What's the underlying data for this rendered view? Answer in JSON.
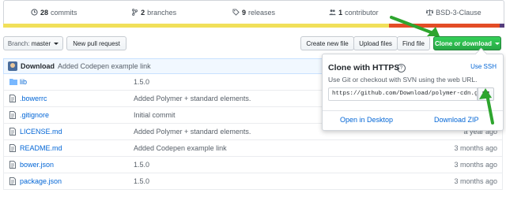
{
  "stats": {
    "commits": {
      "count": "28",
      "label": "commits",
      "icon": "history-icon"
    },
    "branches": {
      "count": "2",
      "label": "branches",
      "icon": "branch-icon"
    },
    "releases": {
      "count": "9",
      "label": "releases",
      "icon": "tag-icon"
    },
    "contributors": {
      "count": "1",
      "label": "contributor",
      "icon": "people-icon"
    },
    "license": {
      "label": "BSD-3-Clause",
      "icon": "law-icon"
    }
  },
  "colors": {
    "lang_yellow": "#f1e05a",
    "lang_red": "#e34c26",
    "lang_blue": "#563d7c",
    "green_button": "#28a745",
    "link": "#0366d6",
    "arrow": "#2ea52e"
  },
  "toolbar": {
    "branch_prefix": "Branch:",
    "branch_name": "master",
    "new_pull_request": "New pull request",
    "create_new_file": "Create new file",
    "upload_files": "Upload files",
    "find_file": "Find file",
    "clone_download": "Clone or download"
  },
  "latest_commit": {
    "author": "Download",
    "message": "Added Codepen example link"
  },
  "files": [
    {
      "name": "lib",
      "type": "folder",
      "message": "1.5.0",
      "age": ""
    },
    {
      "name": ".bowerrc",
      "type": "file",
      "message": "Added Polymer + standard elements.",
      "age": ""
    },
    {
      "name": ".gitignore",
      "type": "file",
      "message": "Initial commit",
      "age": ""
    },
    {
      "name": "LICENSE.md",
      "type": "file",
      "message": "Added Polymer + standard elements.",
      "age": "a year ago"
    },
    {
      "name": "README.md",
      "type": "file",
      "message": "Added Codepen example link",
      "age": "3 months ago"
    },
    {
      "name": "bower.json",
      "type": "file",
      "message": "1.5.0",
      "age": "3 months ago"
    },
    {
      "name": "package.json",
      "type": "file",
      "message": "1.5.0",
      "age": "3 months ago"
    }
  ],
  "clone_popup": {
    "title": "Clone with HTTPS",
    "help": "?",
    "use_ssh": "Use SSH",
    "description": "Use Git or checkout with SVN using the web URL.",
    "url": "https://github.com/Download/polymer-cdn.git",
    "open_desktop": "Open in Desktop",
    "download_zip": "Download ZIP"
  }
}
